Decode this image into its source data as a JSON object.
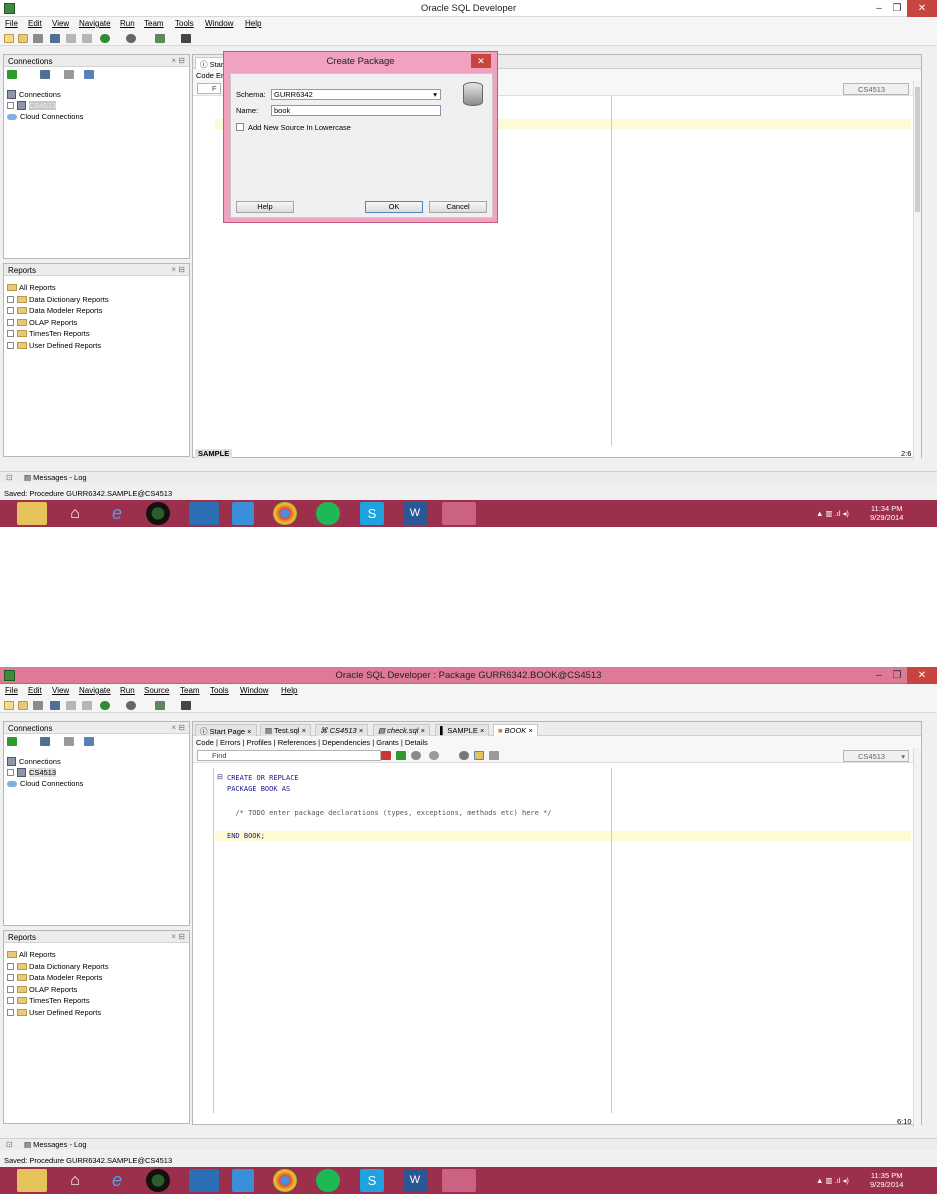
{
  "screenshots": [
    {
      "window_title": "Oracle SQL Developer",
      "menu": [
        "File",
        "Edit",
        "View",
        "Navigate",
        "Run",
        "Team",
        "Tools",
        "Window",
        "Help"
      ],
      "connections_panel": {
        "title": "Connections",
        "root": "Connections",
        "connection": "CS4513",
        "cloud": "Cloud Connections"
      },
      "reports_panel": {
        "title": "Reports",
        "items": [
          "All Reports",
          "Data Dictionary Reports",
          "Data Modeler Reports",
          "OLAP Reports",
          "TimesTen Reports",
          "User Defined Reports"
        ]
      },
      "editor": {
        "first_tab": "Start",
        "subtab_visible": "Code",
        "subtab_truncated": "Er",
        "find_placeholder": "F",
        "connection_select": "CS4513",
        "bottom_tab": "SAMPLE",
        "cursor_pos": "2:6"
      },
      "dialog": {
        "title": "Create Package",
        "schema_label": "Schema:",
        "schema_value": "GURR6342",
        "name_label": "Name:",
        "name_value": "book",
        "lowercase_label": "Add New Source In Lowercase",
        "help_button": "Help",
        "ok_button": "OK",
        "cancel_button": "Cancel"
      },
      "messages_tab": "Messages - Log",
      "status": "Saved: Procedure GURR6342.SAMPLE@CS4513",
      "clock": {
        "time": "11:34 PM",
        "date": "9/29/2014"
      }
    },
    {
      "window_title": "Oracle SQL Developer : Package GURR6342.BOOK@CS4513",
      "menu": [
        "File",
        "Edit",
        "View",
        "Navigate",
        "Run",
        "Source",
        "Team",
        "Tools",
        "Window",
        "Help"
      ],
      "connections_panel": {
        "title": "Connections",
        "root": "Connections",
        "connection": "CS4513",
        "cloud": "Cloud Connections"
      },
      "reports_panel": {
        "title": "Reports",
        "items": [
          "All Reports",
          "Data Dictionary Reports",
          "Data Modeler Reports",
          "OLAP Reports",
          "TimesTen Reports",
          "User Defined Reports"
        ]
      },
      "editor": {
        "tabs": [
          "Start Page",
          "Test.sql",
          "CS4513",
          "check.sql",
          "SAMPLE",
          "BOOK"
        ],
        "subtabs": "Code | Errors | Profiles | References | Dependencies | Grants | Details",
        "find_placeholder": "Find",
        "connection_select": "CS4513",
        "code": [
          "CREATE OR REPLACE",
          "PACKAGE BOOK AS",
          "",
          "  /* TODO enter package declarations (types, exceptions, methods etc) here */",
          "",
          "END BOOK;"
        ],
        "cursor_pos": "6:10"
      },
      "messages_tab": "Messages - Log",
      "status": "Saved: Procedure GURR6342.SAMPLE@CS4513",
      "clock": {
        "time": "11:35 PM",
        "date": "9/29/2014"
      }
    }
  ],
  "colors": {
    "taskbar": "#9c2f4c",
    "titlebar_active": "#dd7a97",
    "dialog_frame": "#f0a2c0",
    "code_keyword": "#1a1a8c",
    "current_line": "#fdfbd6"
  },
  "icons": [
    "app-icon",
    "new-file-icon",
    "open-icon",
    "save-icon",
    "undo-icon",
    "redo-icon",
    "run-icon",
    "debug-icon",
    "database-icon",
    "close-icon",
    "folder-icon",
    "file-explorer-icon",
    "home-icon",
    "ie-icon",
    "chrome-icon",
    "spotify-icon",
    "skype-icon",
    "word-icon"
  ]
}
